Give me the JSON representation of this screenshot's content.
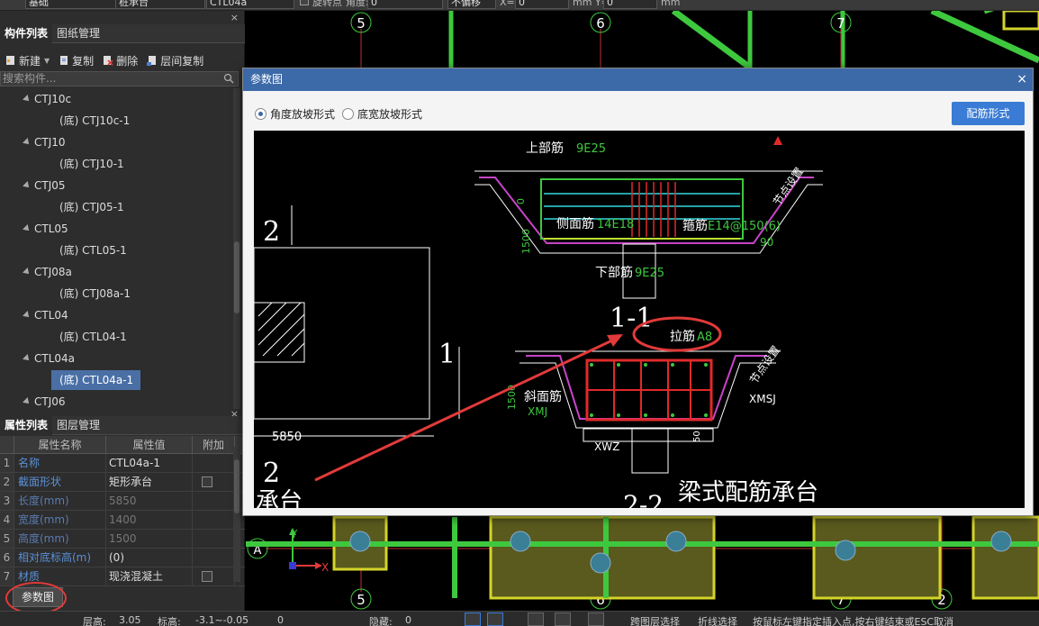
{
  "toolbar": {
    "field1": "基础",
    "field2": "桩承台",
    "field3": "CTL04a",
    "rotate_label": "旋转点",
    "angle_label": "角度:",
    "angle_value": "0",
    "offset_mode": "不偏移",
    "x_label": "X=",
    "x_value": "0",
    "unit1": "mm Y=",
    "y_value": "0",
    "unit2": "mm"
  },
  "left_panel": {
    "close": "×",
    "tabs": [
      "构件列表",
      "图纸管理"
    ],
    "tools": [
      "新建",
      "复制",
      "删除",
      "层间复制"
    ],
    "search_placeholder": "搜索构件...",
    "tree": [
      {
        "type": "parent",
        "label": "CTJ10c"
      },
      {
        "type": "child",
        "label": "(底) CTJ10c-1"
      },
      {
        "type": "parent",
        "label": "CTJ10"
      },
      {
        "type": "child",
        "label": "(底) CTJ10-1"
      },
      {
        "type": "parent",
        "label": "CTJ05"
      },
      {
        "type": "child",
        "label": "(底) CTJ05-1"
      },
      {
        "type": "parent",
        "label": "CTL05"
      },
      {
        "type": "child",
        "label": "(底) CTL05-1"
      },
      {
        "type": "parent",
        "label": "CTJ08a"
      },
      {
        "type": "child",
        "label": "(底) CTJ08a-1"
      },
      {
        "type": "parent",
        "label": "CTL04"
      },
      {
        "type": "child",
        "label": "(底) CTL04-1"
      },
      {
        "type": "parent",
        "label": "CTL04a"
      },
      {
        "type": "child",
        "label": "(底) CTL04a-1",
        "selected": true
      },
      {
        "type": "parent",
        "label": "CTJ06"
      }
    ],
    "prop_tabs": [
      "属性列表",
      "图层管理"
    ],
    "prop_close": "×",
    "prop_headers": [
      "属性名称",
      "属性值",
      "附加"
    ],
    "props": [
      {
        "idx": "1",
        "name": "名称",
        "value": "CTL04a-1",
        "check": false,
        "dim": false
      },
      {
        "idx": "2",
        "name": "截面形状",
        "value": "矩形承台",
        "check": true,
        "dim": false
      },
      {
        "idx": "3",
        "name": "长度(mm)",
        "value": "5850",
        "check": false,
        "dim": true
      },
      {
        "idx": "4",
        "name": "宽度(mm)",
        "value": "1400",
        "check": false,
        "dim": true
      },
      {
        "idx": "5",
        "name": "高度(mm)",
        "value": "1500",
        "check": false,
        "dim": true
      },
      {
        "idx": "6",
        "name": "相对底标高(m)",
        "value": "(0)",
        "check": false,
        "dim": false
      },
      {
        "idx": "7",
        "name": "材质",
        "value": "现浇混凝土",
        "check": true,
        "dim": false
      }
    ],
    "param_button": "参数图"
  },
  "canvas": {
    "axis_top": [
      "5",
      "6",
      "7"
    ],
    "axis_bottom": [
      "5",
      "6",
      "7",
      "2"
    ],
    "axis_left": "A",
    "ucs_x": "X",
    "ucs_y": "Y"
  },
  "dialog": {
    "title": "参数图",
    "close": "×",
    "radio1": "角度放坡形式",
    "radio2": "底宽放坡形式",
    "rebar_button": "配筋形式",
    "drawing": {
      "top_rebar_label": "上部筋",
      "top_rebar_value": "9E25",
      "node_setting": "节点设置",
      "dim_0": "0",
      "dim_1500": "1500",
      "side_rebar_label": "侧面筋",
      "side_rebar_value": "14E18",
      "stirrup_label": "箍筋",
      "stirrup_value": "E14@150(6)",
      "angle_90": "90",
      "bottom_rebar_label": "下部筋",
      "bottom_rebar_value": "9E25",
      "sec_2": "2",
      "sec_1": "1",
      "section_11": "1-1",
      "tie_label": "拉筋",
      "tie_value": "A8",
      "node_setting2": "节点设置",
      "dim_1500b": "1500",
      "slope_rebar_label": "斜面筋",
      "xmj": "XMJ",
      "xmsj": "XMSJ",
      "xwz": "XWZ",
      "dim_50": "50",
      "dim_5850": "5850",
      "sec_2b": "2",
      "cap_partial": "承台",
      "section_22": "2-2",
      "caption": "梁式配筋承台"
    }
  },
  "status": {
    "floor_h": "层高:",
    "floor_h_val": "3.05",
    "elev": "标高:",
    "elev_val": "-3.1~-0.05",
    "zero": "0",
    "hidden": "隐藏:",
    "hidden_val": "0",
    "layer_select": "跨图层选择",
    "polyline_select": "折线选择",
    "hint": "按鼠标左键指定插入点,按右键结束或ESC取消"
  },
  "colors": {
    "accent": "#3a7bd5",
    "dialog_title": "#3c69a8",
    "grid_green": "#3ec83e",
    "annotation_red": "#e23a3a"
  }
}
